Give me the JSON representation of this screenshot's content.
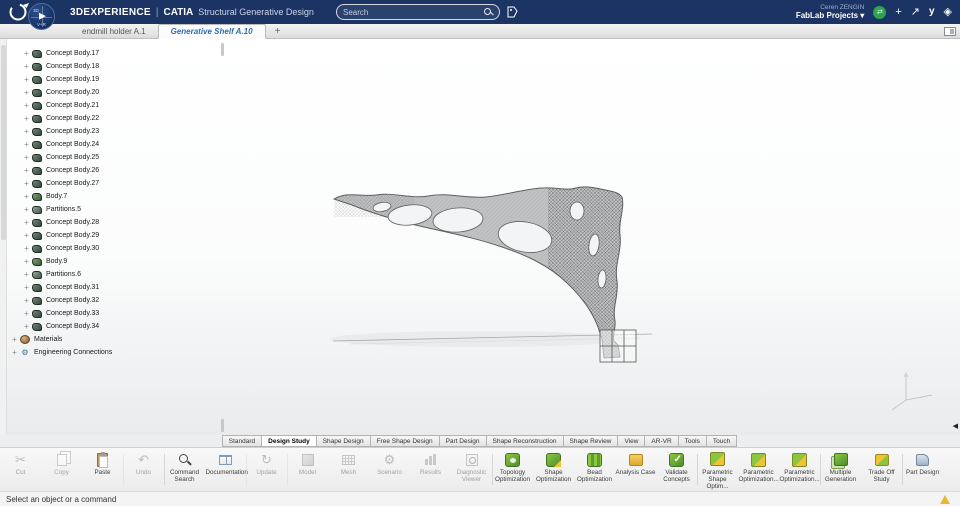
{
  "top_bar": {
    "brand": "3DEXPERIENCE",
    "divider": "|",
    "app": "CATIA",
    "subtitle": "Structural Generative Design",
    "search_placeholder": "Search",
    "user_name": "Ceren ZENGIN",
    "workspace": "FabLab Projects"
  },
  "icons": {
    "play": "▶",
    "compass_3d": "3D",
    "compass_vr": "V+R",
    "caret_down": "▾",
    "plus": "+",
    "share": "↗",
    "sync": "⇄",
    "swym": "y",
    "compass_star": "◈",
    "new_tab": "+",
    "expander": "+",
    "gear": "⚙",
    "collapse_left": "◀",
    "undo": "↶",
    "scissors": "✂",
    "refresh": "↻"
  },
  "document_tabs": [
    {
      "label": "endmill holder A.1",
      "active": false
    },
    {
      "label": "Generative Shelf A.10",
      "active": true
    }
  ],
  "tree": {
    "items": [
      {
        "label": "Concept Body.17",
        "type": "concept",
        "level": 2
      },
      {
        "label": "Concept Body.18",
        "type": "concept",
        "level": 2
      },
      {
        "label": "Concept Body.19",
        "type": "concept",
        "level": 2
      },
      {
        "label": "Concept Body.20",
        "type": "concept",
        "level": 2
      },
      {
        "label": "Concept Body.21",
        "type": "concept",
        "level": 2
      },
      {
        "label": "Concept Body.22",
        "type": "concept",
        "level": 2
      },
      {
        "label": "Concept Body.23",
        "type": "concept",
        "level": 2
      },
      {
        "label": "Concept Body.24",
        "type": "concept",
        "level": 2
      },
      {
        "label": "Concept Body.25",
        "type": "concept",
        "level": 2
      },
      {
        "label": "Concept Body.26",
        "type": "concept",
        "level": 2
      },
      {
        "label": "Concept Body.27",
        "type": "concept",
        "level": 2
      },
      {
        "label": "Body.7",
        "type": "body",
        "level": 2
      },
      {
        "label": "Partitions.5",
        "type": "part",
        "level": 2
      },
      {
        "label": "Concept Body.28",
        "type": "concept",
        "level": 2
      },
      {
        "label": "Concept Body.29",
        "type": "concept",
        "level": 2
      },
      {
        "label": "Concept Body.30",
        "type": "concept",
        "level": 2
      },
      {
        "label": "Body.9",
        "type": "body",
        "level": 2
      },
      {
        "label": "Partitions.6",
        "type": "part",
        "level": 2
      },
      {
        "label": "Concept Body.31",
        "type": "concept",
        "level": 2
      },
      {
        "label": "Concept Body.32",
        "type": "concept",
        "level": 2
      },
      {
        "label": "Concept Body.33",
        "type": "concept",
        "level": 2
      },
      {
        "label": "Concept Body.34",
        "type": "concept",
        "level": 2
      },
      {
        "label": "Materials",
        "type": "mat",
        "level": 1
      },
      {
        "label": "Engineering Connections",
        "type": "conn",
        "level": 1
      }
    ]
  },
  "ribbon": {
    "tabs": [
      "Standard",
      "Design Study",
      "Shape Design",
      "Free Shape Design",
      "Part Design",
      "Shape Reconstruction",
      "Shape Review",
      "View",
      "AR-VR",
      "Tools",
      "Touch"
    ],
    "active": "Design Study"
  },
  "toolbar": {
    "items": [
      {
        "label": "Cut",
        "icon": "scissors-icon",
        "glyph": "scissors",
        "disabled": true
      },
      {
        "label": "Copy",
        "icon": "copy-icon",
        "cls": "ic-page2",
        "disabled": true
      },
      {
        "label": "Paste",
        "icon": "clipboard-icon",
        "cls": "ic-clip",
        "disabled": false
      },
      {
        "label": "Undo",
        "icon": "undo-icon",
        "glyph": "undo",
        "disabled": true,
        "sep": true
      },
      {
        "label": "Command Search",
        "icon": "magnifier-icon",
        "cls": "ic-mag",
        "disabled": false,
        "sep": true
      },
      {
        "label": "Documentation",
        "icon": "book-icon",
        "cls": "ic-book",
        "disabled": false
      },
      {
        "label": "Update",
        "icon": "refresh-icon",
        "glyph": "refresh",
        "disabled": true,
        "sep": true
      },
      {
        "label": "Model",
        "icon": "cube-icon",
        "cls": "ic-cube",
        "disabled": true,
        "sep": true
      },
      {
        "label": "Mesh",
        "icon": "mesh-grid-icon",
        "cls": "ic-grid",
        "disabled": true
      },
      {
        "label": "Scenario",
        "icon": "gear-icon",
        "glyph": "gear",
        "disabled": true
      },
      {
        "label": "Results",
        "icon": "bar-chart-icon",
        "cls": "ic-bars",
        "disabled": true
      },
      {
        "label": "Diagnostic Viewer",
        "icon": "diagnostic-viewer-icon",
        "cls": "ic-diag",
        "disabled": true
      },
      {
        "label": "Topology Optimization",
        "icon": "topology-optimization-icon",
        "cls": "ic-green hole",
        "disabled": false,
        "sep": true
      },
      {
        "label": "Shape Optimization",
        "icon": "shape-optimization-icon",
        "cls": "ic-green arrow",
        "disabled": false
      },
      {
        "label": "Bead Optimization",
        "icon": "bead-optimization-icon",
        "cls": "ic-green ridges",
        "disabled": false
      },
      {
        "label": "Analysis Case",
        "icon": "analysis-case-icon",
        "cls": "ic-case",
        "disabled": false
      },
      {
        "label": "Validate Concepts",
        "icon": "validate-concepts-icon",
        "cls": "ic-green check",
        "disabled": false
      },
      {
        "label": "Parametric Shape Optim...",
        "icon": "parametric-shape-optimization-icon",
        "cls": "ic-mix",
        "disabled": false,
        "sep": true
      },
      {
        "label": "Parametric Optimization...",
        "icon": "parametric-optimization-icon",
        "cls": "ic-mix",
        "disabled": false
      },
      {
        "label": "Parametric Optimization...",
        "icon": "parametric-optimization-icon",
        "cls": "ic-mix",
        "disabled": false
      },
      {
        "label": "Multiple Generation",
        "icon": "multiple-generation-icon",
        "cls": "ic-stack",
        "disabled": false,
        "sep": true
      },
      {
        "label": "Trade Off Study",
        "icon": "trade-off-study-icon",
        "cls": "ic-trade",
        "disabled": false
      },
      {
        "label": "Part Design",
        "icon": "part-design-icon",
        "cls": "ic-part",
        "disabled": false,
        "sep": true
      }
    ]
  },
  "status_bar": {
    "message": "Select an object or a command"
  },
  "colors": {
    "topbar_bg": "#1b3463",
    "active_tab_text": "#2f6fae",
    "optimization_green": "#8cc63f",
    "accent_yellow": "#f2c230",
    "warning_yellow": "#eab63a",
    "model_gray": "#bfc1c3"
  }
}
